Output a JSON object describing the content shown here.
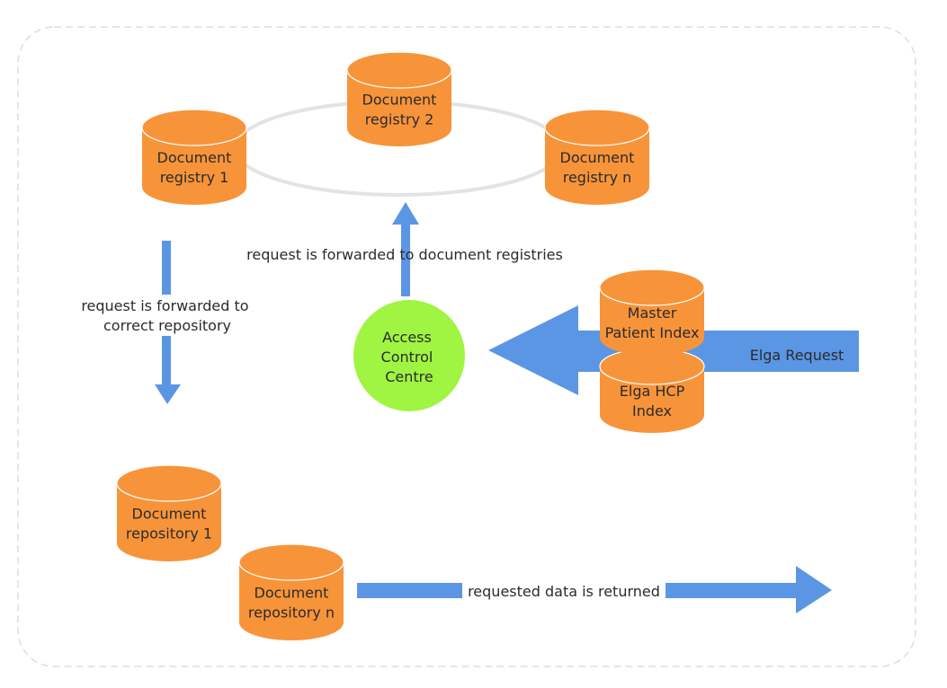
{
  "colors": {
    "database": "#F7943A",
    "arrow": "#5B96E4",
    "access_control": "#9FF542",
    "ring": "#E3E3E3",
    "border": "#DDDDDD"
  },
  "nodes": {
    "registry_1": [
      "Document",
      "registry 1"
    ],
    "registry_2": [
      "Document",
      "registry 2"
    ],
    "registry_n": [
      "Document",
      "registry n"
    ],
    "repository_1": [
      "Document",
      "repository 1"
    ],
    "repository_n": [
      "Document",
      "repository n"
    ],
    "master_patient_index": [
      "Master",
      "Patient Index"
    ],
    "elga_hcp_index": [
      "Elga HCP",
      "Index"
    ],
    "access_control_centre": [
      "Access",
      "Control",
      "Centre"
    ]
  },
  "labels": {
    "forward_registries": "request is forwarded to document registries",
    "forward_repository": [
      "request is forwarded to",
      "correct repository"
    ],
    "elga_request": "Elga Request",
    "data_returned": "requested data is returned"
  }
}
